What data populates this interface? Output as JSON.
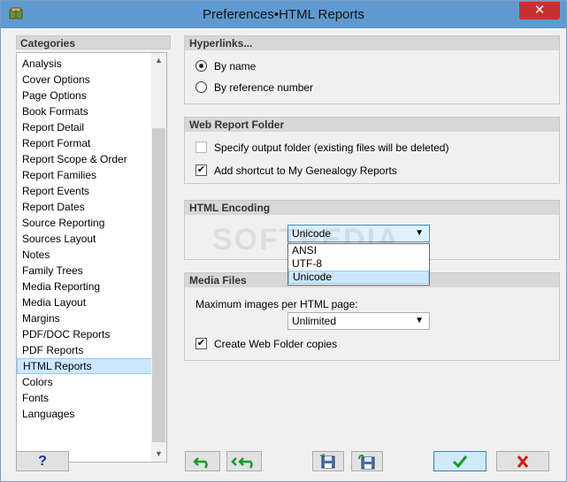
{
  "window": {
    "title": "Preferences•HTML Reports",
    "close_glyph": "✕"
  },
  "categories": {
    "header": "Categories",
    "items": [
      {
        "label": "Analysis"
      },
      {
        "label": "Cover Options"
      },
      {
        "label": "Page Options"
      },
      {
        "label": "Book Formats"
      },
      {
        "label": "Report Detail"
      },
      {
        "label": "Report Format"
      },
      {
        "label": "Report Scope & Order"
      },
      {
        "label": "Report Families"
      },
      {
        "label": "Report Events"
      },
      {
        "label": "Report Dates"
      },
      {
        "label": "Source Reporting"
      },
      {
        "label": "Sources Layout"
      },
      {
        "label": "Notes"
      },
      {
        "label": "Family Trees"
      },
      {
        "label": "Media Reporting"
      },
      {
        "label": "Media Layout"
      },
      {
        "label": "Margins"
      },
      {
        "label": "PDF/DOC Reports"
      },
      {
        "label": "PDF Reports"
      },
      {
        "label": "HTML Reports",
        "selected": true
      },
      {
        "label": "Colors"
      },
      {
        "label": "Fonts"
      },
      {
        "label": "Languages"
      }
    ],
    "scroll_up": "▲",
    "scroll_down": "▼"
  },
  "hyperlinks": {
    "header": "Hyperlinks...",
    "by_name": "By name",
    "by_reference": "By reference number",
    "selected": "by_name"
  },
  "web_folder": {
    "header": "Web Report Folder",
    "specify_output": "Specify output folder (existing files will be deleted)",
    "specify_output_checked": false,
    "add_shortcut": "Add shortcut to My Genealogy Reports",
    "add_shortcut_checked": true
  },
  "encoding": {
    "header": "HTML Encoding",
    "value": "Unicode",
    "options": [
      "ANSI",
      "UTF-8",
      "Unicode"
    ],
    "arrow": "▼"
  },
  "media": {
    "header": "Media Files",
    "max_images_label": "Maximum images per HTML page:",
    "max_images_value": "Unlimited",
    "create_copies": "Create Web Folder copies",
    "create_copies_checked": true,
    "arrow": "▼"
  },
  "watermark": "SOFTPEDIA",
  "buttons": {
    "help": "?",
    "check_glyph": "✔"
  },
  "icons": {
    "app": "app-book-icon",
    "undo": "undo-icon",
    "undo_all": "undo-all-icon",
    "save": "save-icon",
    "load": "load-icon",
    "ok": "checkmark-icon",
    "cancel": "cross-icon"
  },
  "colors": {
    "titlebar": "#5e9ad1",
    "close": "#c7312b",
    "selection": "#cce8ff",
    "ok_green": "#1a9a2a",
    "cancel_red": "#d41c1c"
  }
}
